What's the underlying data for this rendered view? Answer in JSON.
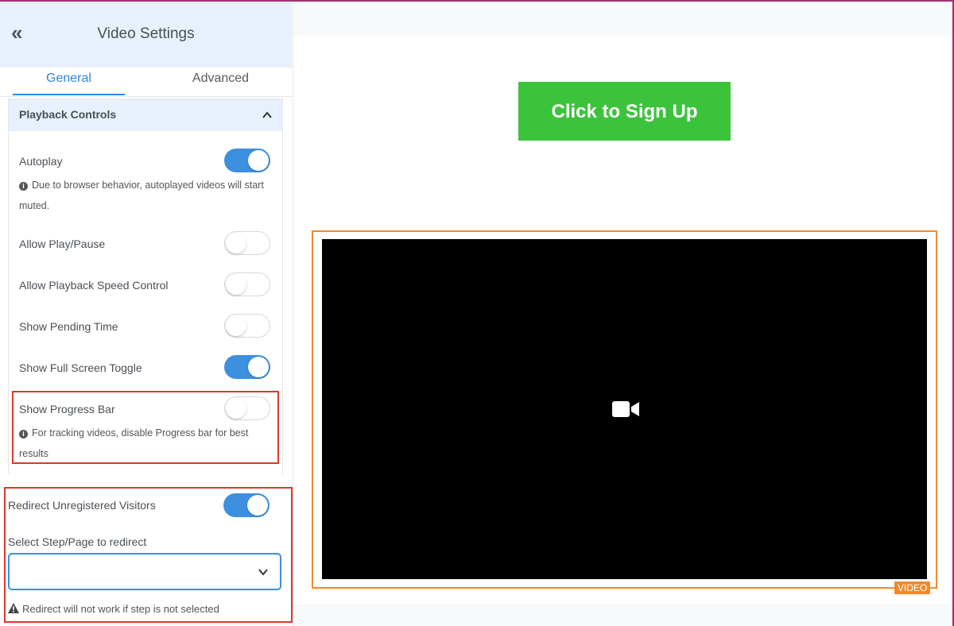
{
  "sidebar": {
    "title": "Video Settings",
    "tabs": {
      "general": "General",
      "advanced": "Advanced"
    },
    "section_title": "Playback Controls",
    "autoplay": {
      "label": "Autoplay",
      "on": true,
      "note": "Due to browser behavior, autoplayed videos will start muted."
    },
    "play_pause": {
      "label": "Allow Play/Pause",
      "on": false
    },
    "speed": {
      "label": "Allow Playback Speed Control",
      "on": false
    },
    "pending_time": {
      "label": "Show Pending Time",
      "on": false
    },
    "fullscreen": {
      "label": "Show Full Screen Toggle",
      "on": true
    },
    "progress_bar": {
      "label": "Show Progress Bar",
      "on": false,
      "note": "For tracking videos, disable Progress bar for best results"
    },
    "redirect": {
      "label": "Redirect Unregistered Visitors",
      "on": true
    },
    "select_label": "Select Step/Page to redirect",
    "select_value": "",
    "warning": "Redirect will not work if step is not selected"
  },
  "main": {
    "cta_label": "Click to Sign Up",
    "video_badge": "VIDEO"
  },
  "colors": {
    "accent": "#3d8fe0",
    "cta": "#3bc43b",
    "video_outline": "#f08a2c",
    "highlight": "#e0362c"
  }
}
